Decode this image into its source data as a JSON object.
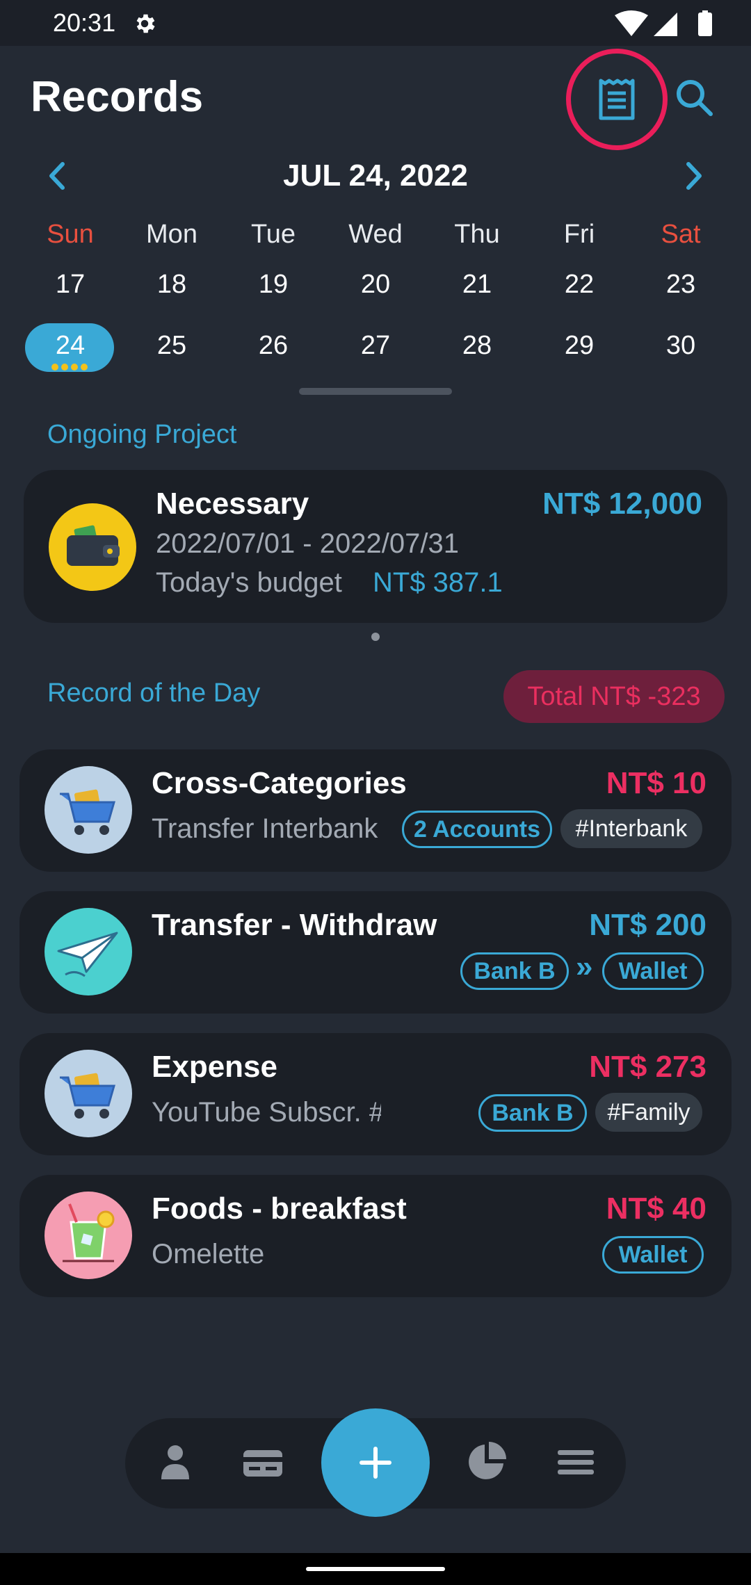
{
  "status": {
    "time": "20:31"
  },
  "header": {
    "title": "Records"
  },
  "calendar": {
    "title": "JUL 24, 2022",
    "weekdays": [
      "Sun",
      "Mon",
      "Tue",
      "Wed",
      "Thu",
      "Fri",
      "Sat"
    ],
    "week1": [
      "17",
      "18",
      "19",
      "20",
      "21",
      "22",
      "23"
    ],
    "week2": [
      "24",
      "25",
      "26",
      "27",
      "28",
      "29",
      "30"
    ],
    "selected_day": "24"
  },
  "ongoing": {
    "label": "Ongoing Project",
    "name": "Necessary",
    "amount": "NT$ 12,000",
    "dates": "2022/07/01 - 2022/07/31",
    "budget_label": "Today's budget",
    "budget_value": "NT$ 387.1"
  },
  "day": {
    "label": "Record of the Day",
    "total": "Total NT$ -323"
  },
  "records": [
    {
      "title": "Cross-Categories",
      "amount": "NT$ 10",
      "note": "Transfer Interbank",
      "tag_outline": "2 Accounts",
      "tag_filled": "#Interbank"
    },
    {
      "title": "Transfer - Withdraw",
      "amount": "NT$ 200",
      "from": "Bank B",
      "arrow": "»",
      "to": "Wallet"
    },
    {
      "title": "Expense",
      "amount": "NT$ 273",
      "note": "YouTube Subscr. #",
      "tag_outline": "Bank B",
      "tag_filled": "#Family"
    },
    {
      "title": "Foods - breakfast",
      "amount": "NT$ 40",
      "note": "Omelette",
      "tag_outline": "Wallet"
    }
  ],
  "fab": {
    "label": "+"
  },
  "colors": {
    "accent": "#3aa9d6",
    "expense": "#ec2f62",
    "highlight": "#ea1e5a",
    "weekend": "#e8503f"
  }
}
